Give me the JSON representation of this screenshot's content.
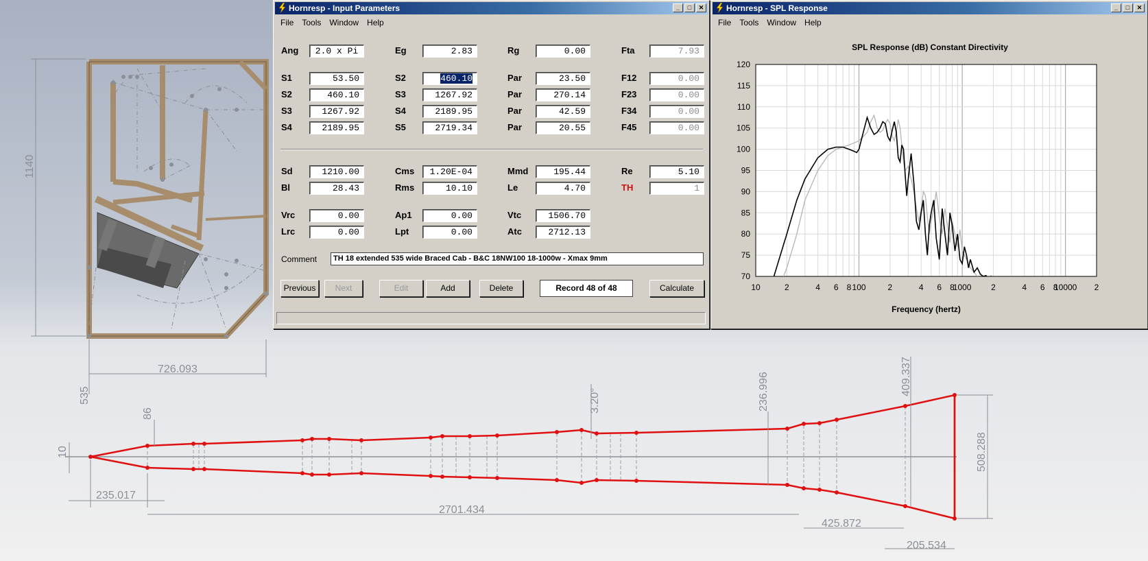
{
  "cad": {
    "dims": {
      "height": "1140",
      "width": "726.093",
      "depth": "535",
      "d86": "86",
      "d10": "10",
      "d235": "235.017",
      "d2701": "2701.434",
      "d320": "3.20°",
      "d236": "236.996",
      "d409": "409.337",
      "d508": "508.288",
      "d425": "425.872",
      "d205": "205.534"
    },
    "colors": {
      "wood": "#a78d6c",
      "horn": "#e01010",
      "steel": "#5a5a5a"
    }
  },
  "input_window": {
    "title": "Hornresp - Input Parameters",
    "menu": [
      "File",
      "Tools",
      "Window",
      "Help"
    ],
    "rows": [
      {
        "label": "Ang",
        "value": "2.0 x Pi",
        "center": true
      },
      {
        "label": "Eg",
        "value": "2.83"
      },
      {
        "label": "Rg",
        "value": "0.00"
      },
      {
        "label": "Fta",
        "value": "7.93",
        "gray": true
      },
      {
        "label": "S1",
        "value": "53.50"
      },
      {
        "label": "S2",
        "value": "460.10",
        "selected": true
      },
      {
        "label": "Par",
        "value": "23.50"
      },
      {
        "label": "F12",
        "value": "0.00",
        "gray": true
      },
      {
        "label": "S2",
        "value": "460.10"
      },
      {
        "label": "S3",
        "value": "1267.92"
      },
      {
        "label": "Par",
        "value": "270.14"
      },
      {
        "label": "F23",
        "value": "0.00",
        "gray": true
      },
      {
        "label": "S3",
        "value": "1267.92"
      },
      {
        "label": "S4",
        "value": "2189.95"
      },
      {
        "label": "Par",
        "value": "42.59"
      },
      {
        "label": "F34",
        "value": "0.00",
        "gray": true
      },
      {
        "label": "S4",
        "value": "2189.95"
      },
      {
        "label": "S5",
        "value": "2719.34"
      },
      {
        "label": "Par",
        "value": "20.55"
      },
      {
        "label": "F45",
        "value": "0.00",
        "gray": true
      },
      {
        "label": "Sd",
        "value": "1210.00"
      },
      {
        "label": "Cms",
        "value": "1.20E-04"
      },
      {
        "label": "Mmd",
        "value": "195.44"
      },
      {
        "label": "Re",
        "value": "5.10"
      },
      {
        "label": "Bl",
        "value": "28.43"
      },
      {
        "label": "Rms",
        "value": "10.10"
      },
      {
        "label": "Le",
        "value": "4.70"
      },
      {
        "label": "TH",
        "value": "1",
        "gray": true,
        "red": true
      },
      {
        "label": "Vrc",
        "value": "0.00"
      },
      {
        "label": "Ap1",
        "value": "0.00"
      },
      {
        "label": "Vtc",
        "value": "1506.70"
      },
      {
        "label": "Lrc",
        "value": "0.00"
      },
      {
        "label": "Lpt",
        "value": "0.00"
      },
      {
        "label": "Atc",
        "value": "2712.13"
      }
    ],
    "comment_label": "Comment",
    "comment": "TH 18  extended 535 wide Braced Cab - B&C 18NW100 18-1000w - Xmax 9mm",
    "buttons": {
      "previous": "Previous",
      "next": "Next",
      "edit": "Edit",
      "add": "Add",
      "delete": "Delete",
      "calculate": "Calculate"
    },
    "record": "Record 48 of 48"
  },
  "spl_window": {
    "title": "Hornresp - SPL Response",
    "menu": [
      "File",
      "Tools",
      "Window",
      "Help"
    ]
  },
  "chart_data": {
    "type": "line",
    "title": "SPL Response (dB)   Constant Directivity",
    "xlabel": "Frequency (hertz)",
    "ylabel": "",
    "xscale": "log",
    "xlim": [
      10,
      20000
    ],
    "ylim": [
      70,
      120
    ],
    "yticks": [
      120,
      115,
      110,
      105,
      100,
      95,
      90,
      85,
      80,
      75,
      70
    ],
    "xtick_labels": [
      {
        "f": 10,
        "t": "10"
      },
      {
        "f": 20,
        "t": "2"
      },
      {
        "f": 40,
        "t": "4"
      },
      {
        "f": 60,
        "t": "6"
      },
      {
        "f": 80,
        "t": "8"
      },
      {
        "f": 100,
        "t": "100"
      },
      {
        "f": 200,
        "t": "2"
      },
      {
        "f": 400,
        "t": "4"
      },
      {
        "f": 600,
        "t": "6"
      },
      {
        "f": 800,
        "t": "8"
      },
      {
        "f": 1000,
        "t": "1000"
      },
      {
        "f": 2000,
        "t": "2"
      },
      {
        "f": 4000,
        "t": "4"
      },
      {
        "f": 6000,
        "t": "6"
      },
      {
        "f": 8000,
        "t": "8"
      },
      {
        "f": 10000,
        "t": "10000"
      },
      {
        "f": 20000,
        "t": "2"
      }
    ],
    "grid": true,
    "series": [
      {
        "color": "#000000",
        "x": [
          10,
          15,
          20,
          25,
          30,
          40,
          50,
          60,
          70,
          80,
          90,
          95,
          100,
          110,
          120,
          130,
          140,
          150,
          160,
          170,
          180,
          190,
          200,
          210,
          220,
          230,
          240,
          250,
          260,
          270,
          280,
          290,
          300,
          320,
          340,
          360,
          380,
          400,
          420,
          440,
          460,
          480,
          500,
          530,
          560,
          600,
          640,
          680,
          720,
          760,
          800,
          850,
          900,
          950,
          1000,
          1050,
          1100,
          1150,
          1200,
          1300,
          1400,
          1500,
          1600,
          1700,
          1800,
          1900,
          2000
        ],
        "y": [
          60,
          70,
          80,
          88,
          93,
          98,
          100,
          100.5,
          100.5,
          100,
          99.5,
          99.2,
          100,
          104,
          107.5,
          105,
          103.5,
          104,
          105,
          106.5,
          106,
          103,
          102,
          104.5,
          106.5,
          104,
          98,
          97,
          101,
          100,
          94,
          89,
          93,
          99,
          92,
          83,
          81,
          85,
          88,
          80,
          75,
          82,
          85,
          88,
          79,
          74,
          86,
          80,
          75,
          85,
          82,
          76,
          80,
          74,
          73,
          77,
          75,
          72,
          74,
          71,
          72,
          70.5,
          70,
          70.2,
          69,
          70,
          69
        ]
      },
      {
        "color": "#b4b4b4",
        "x": [
          10,
          15,
          20,
          25,
          30,
          40,
          50,
          60,
          70,
          80,
          90,
          100,
          110,
          120,
          130,
          140,
          150,
          160,
          170,
          180,
          190,
          200,
          210,
          220,
          230,
          240,
          250,
          260,
          270,
          280,
          300,
          320,
          340,
          360,
          380,
          400,
          420,
          440,
          460,
          480,
          500,
          530,
          560,
          600,
          640,
          680,
          720,
          760,
          800,
          850,
          900,
          950,
          1000,
          1100,
          1200,
          1300,
          1400,
          1500
        ],
        "y": [
          55,
          64,
          72,
          80,
          88,
          95,
          98.5,
          100,
          100.5,
          101,
          101.5,
          102,
          103,
          104,
          106.5,
          108,
          105,
          104,
          104.5,
          106,
          107,
          106,
          103,
          102,
          104,
          107,
          105,
          101,
          97,
          95,
          96,
          93,
          90,
          86,
          83,
          86,
          90,
          89,
          84,
          80,
          83,
          86,
          90,
          84,
          80,
          86,
          82,
          78,
          83,
          80,
          77,
          81,
          76,
          74,
          72,
          71,
          70,
          69
        ]
      }
    ]
  }
}
